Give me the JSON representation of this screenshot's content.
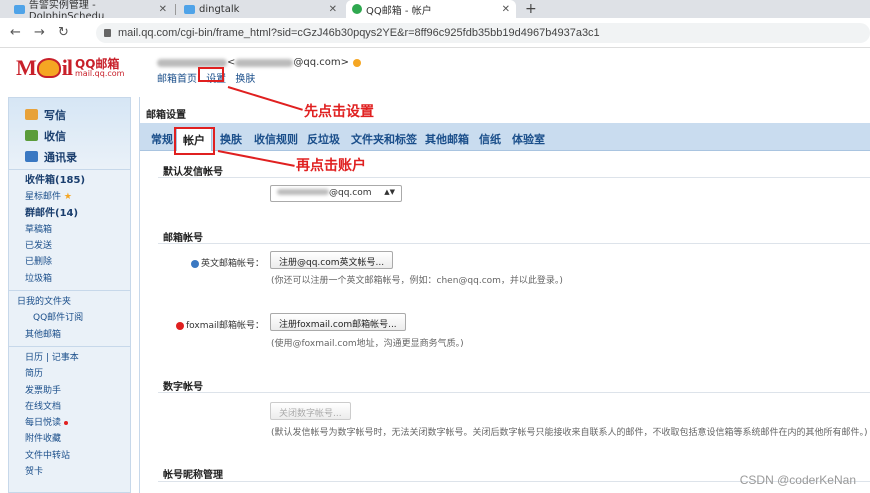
{
  "browser": {
    "tabs": [
      {
        "title": "告警实例管理 - DolphinSchedu"
      },
      {
        "title": "dingtalk"
      },
      {
        "title": "QQ邮箱 - 帐户"
      }
    ],
    "url": "mail.qq.com/cgi-bin/frame_html?sid=cGzJ46b30pqys2YE&r=8ff96c925fdb35bb19d4967b4937a3c1"
  },
  "header": {
    "logo_text": "QQ邮箱",
    "logo_sub": "mail.qq.com",
    "account_suffix": "@qq.com>",
    "links": [
      "邮箱首页",
      "设置",
      "换肤"
    ]
  },
  "annotations": {
    "step1": "先点击设置",
    "step2": "再点击账户"
  },
  "sidebar": {
    "actions": [
      "写信",
      "收信",
      "通讯录"
    ],
    "folders": [
      "收件箱(185)",
      "星标邮件",
      "群邮件(14)",
      "草稿箱",
      "已发送",
      "已删除",
      "垃圾箱"
    ],
    "my_folders": [
      "日我的文件夹",
      "QQ邮件订阅",
      "其他邮箱"
    ],
    "tools_row": "日历 | 记事本",
    "tools": [
      "简历",
      "发票助手",
      "在线文档",
      "每日悦读",
      "附件收藏",
      "文件中转站",
      "贺卡"
    ]
  },
  "settings": {
    "title": "邮箱设置",
    "tabs": [
      "常规",
      "帐户",
      "换肤",
      "收信规则",
      "反垃圾",
      "文件夹和标签",
      "其他邮箱",
      "信纸",
      "体验室"
    ],
    "active_tab": "帐户",
    "default_sender_heading": "默认发信帐号",
    "default_sender_value": "@qq.com",
    "mailbox_heading": "邮箱帐号",
    "english_label": "英文邮箱帐号：",
    "english_button": "注册@qq.com英文帐号...",
    "english_hint": "(你还可以注册一个英文邮箱帐号，例如：chen@qq.com，并以此登录。)",
    "foxmail_label": "foxmail邮箱帐号：",
    "foxmail_button": "注册foxmail.com邮箱帐号...",
    "foxmail_hint": "(使用@foxmail.com地址，沟通更显商务气质。)",
    "digital_heading": "数字帐号",
    "digital_button": "关闭数字帐号...",
    "digital_hint": "(默认发信帐号为数字帐号时，无法关闭数字帐号。关闭后数字帐号只能接收来自联系人的邮件，不收取包括意设信箱等系统邮件在内的其他所有邮件。)",
    "alias_heading": "帐号昵称管理"
  },
  "watermark": "CSDN @coderKeNan"
}
